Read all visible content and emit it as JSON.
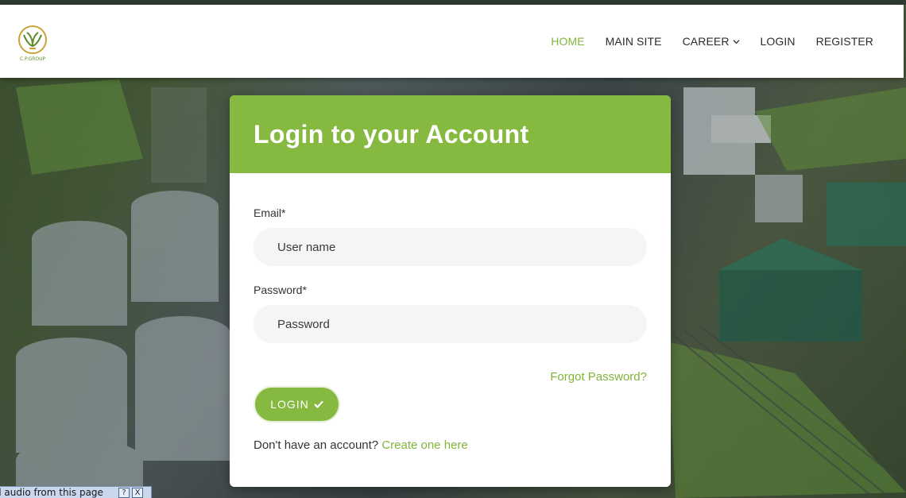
{
  "nav": {
    "items": [
      "HOME",
      "MAIN SITE",
      "CAREER",
      "LOGIN",
      "REGISTER"
    ],
    "active": "HOME",
    "career_has_dropdown": true,
    "logo_text": "C.P.GROUP"
  },
  "card": {
    "title": "Login to your Account",
    "email_label": "Email*",
    "email_placeholder": "User name",
    "password_label": "Password*",
    "password_placeholder": "Password",
    "forgot_link": "Forgot Password?",
    "login_button": "LOGIN",
    "signup_text": "Don't have an account?",
    "signup_link": "Create one here"
  },
  "audio_bar": {
    "text": "d audio from this page",
    "help": "?",
    "close": "X"
  },
  "colors": {
    "accent": "#85b940",
    "nav_active": "#80b53a",
    "field_bg": "#f4f5f6"
  },
  "icons": {
    "career_dropdown": "chevron-down-icon",
    "login_check": "check-icon",
    "logo": "cp-group-logo"
  }
}
